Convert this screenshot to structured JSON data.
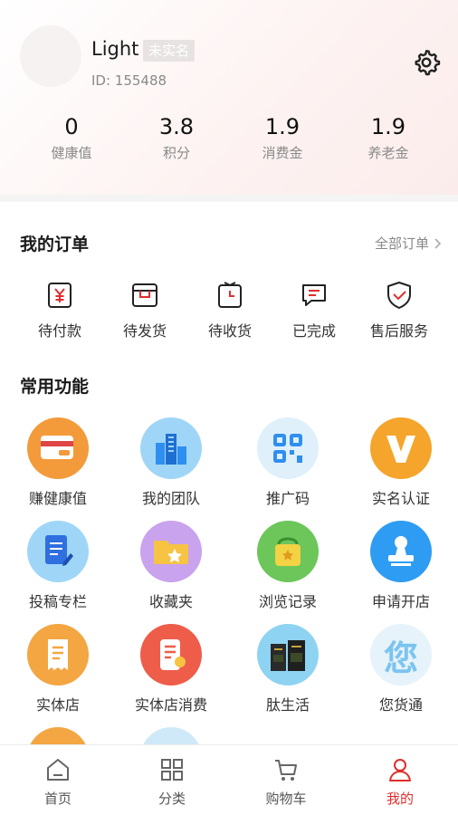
{
  "profile": {
    "name": "Light",
    "verify_status": "未实名",
    "id_text": "ID: 155488",
    "stats": [
      {
        "value": "0",
        "label": "健康值"
      },
      {
        "value": "3.8",
        "label": "积分"
      },
      {
        "value": "1.9",
        "label": "消费金"
      },
      {
        "value": "1.9",
        "label": "养老金"
      }
    ]
  },
  "orders": {
    "title": "我的订单",
    "all_label": "全部订单",
    "items": [
      {
        "label": "待付款",
        "icon": "yen-wallet-icon"
      },
      {
        "label": "待发货",
        "icon": "package-icon"
      },
      {
        "label": "待收货",
        "icon": "clock-box-icon"
      },
      {
        "label": "已完成",
        "icon": "chat-check-icon"
      },
      {
        "label": "售后服务",
        "icon": "shield-check-icon"
      }
    ]
  },
  "functions": {
    "title": "常用功能",
    "items": [
      {
        "label": "赚健康值",
        "icon": "card-icon"
      },
      {
        "label": "我的团队",
        "icon": "buildings-icon"
      },
      {
        "label": "推广码",
        "icon": "qrcode-icon"
      },
      {
        "label": "实名认证",
        "icon": "v-badge-icon"
      },
      {
        "label": "投稿专栏",
        "icon": "document-pen-icon"
      },
      {
        "label": "收藏夹",
        "icon": "folder-star-icon"
      },
      {
        "label": "浏览记录",
        "icon": "bag-icon"
      },
      {
        "label": "申请开店",
        "icon": "stamp-icon"
      },
      {
        "label": "实体店",
        "icon": "receipt-icon"
      },
      {
        "label": "实体店消费",
        "icon": "phone-receipt-icon"
      },
      {
        "label": "肽生活",
        "icon": "product-boxes-icon"
      },
      {
        "label": "您货通",
        "icon": "nin-char-icon",
        "glyph": "您"
      }
    ]
  },
  "tabbar": {
    "tabs": [
      {
        "label": "首页",
        "icon": "home-icon"
      },
      {
        "label": "分类",
        "icon": "grid-icon"
      },
      {
        "label": "购物车",
        "icon": "cart-icon"
      },
      {
        "label": "我的",
        "icon": "person-icon",
        "active": true
      }
    ]
  },
  "colors": {
    "accent": "#e02d2d",
    "orange": "#f5a52c",
    "blue": "#2f8ff0",
    "green": "#5cc04a",
    "purple": "#c07be8"
  }
}
